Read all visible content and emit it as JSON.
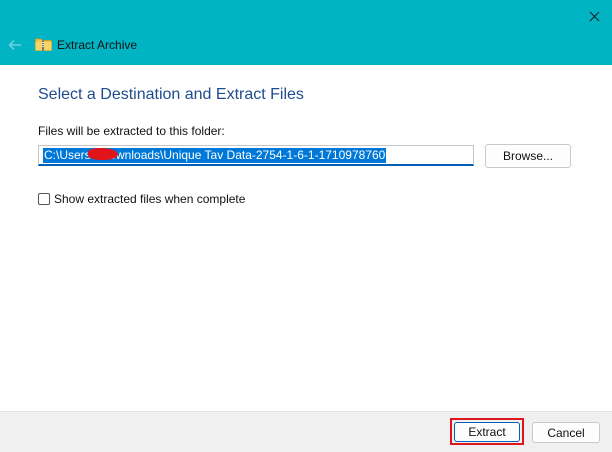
{
  "window": {
    "title": "Extract Archive",
    "titlebar_color": "#00b4c4"
  },
  "titlebar": {
    "back_icon": "back-arrow-icon",
    "folder_icon": "zip-folder-icon",
    "close_icon": "close-icon"
  },
  "main": {
    "heading": "Select a Destination and Extract Files",
    "folder_label": "Files will be extracted to this folder:",
    "path_value": "C:\\Users\\       \\Downloads\\Unique Tav Data-2754-1-6-1-1710978760",
    "browse_label": "Browse...",
    "show_files_label": "Show extracted files when complete",
    "show_files_checked": false
  },
  "footer": {
    "extract_label": "Extract",
    "cancel_label": "Cancel",
    "highlight_color": "#e0151b"
  }
}
